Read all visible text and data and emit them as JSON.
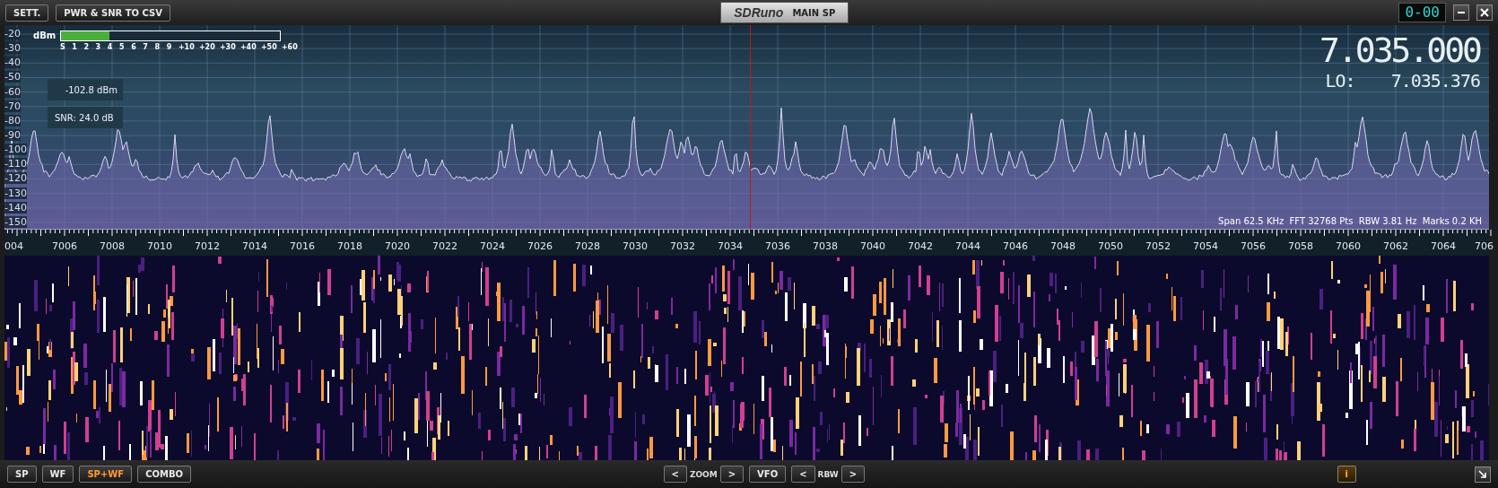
{
  "title_bar": {
    "buttons": [
      "SETT.",
      "PWR & SNR TO CSV"
    ],
    "logo": "SDRuno",
    "window_title": "MAIN SP",
    "clock": "0-00"
  },
  "spectrum": {
    "y_axis_labels": [
      "-20",
      "-30",
      "-40",
      "-50",
      "-60",
      "-70",
      "-80",
      "-90",
      "-100",
      "-110",
      "-120",
      "-130",
      "-140",
      "-150"
    ],
    "s_meter": {
      "unit": "dBm",
      "level": 0.22,
      "scale": [
        "S",
        "1",
        "2",
        "3",
        "4",
        "5",
        "6",
        "7",
        "8",
        "9",
        "+10",
        "+20",
        "+30",
        "+40",
        "+50",
        "+60"
      ]
    },
    "power_reading": "-102.8 dBm",
    "snr_reading": "SNR: 24.0 dB",
    "frequency": "7.035.000",
    "lo_label": "LO:",
    "lo_frequency": "7.035.376",
    "info": "Span 62.5 KHz  FFT 32768 Pts  RBW 3.81 Hz  Marks 0.2 KH"
  },
  "frequency_axis": [
    "004",
    "7006",
    "7008",
    "7010",
    "7012",
    "7014",
    "7016",
    "7018",
    "7020",
    "7022",
    "7024",
    "7026",
    "7028",
    "7030",
    "7032",
    "7034",
    "7036",
    "7038",
    "7040",
    "7042",
    "7044",
    "7046",
    "7048",
    "7050",
    "7052",
    "7054",
    "7056",
    "7058",
    "7060",
    "7062",
    "7064",
    "706"
  ],
  "bottom_bar": {
    "modes": [
      {
        "label": "SP",
        "selected": false
      },
      {
        "label": "WF",
        "selected": false
      },
      {
        "label": "SP+WF",
        "selected": true
      },
      {
        "label": "COMBO",
        "selected": false
      }
    ],
    "zoom": {
      "prev": "<",
      "label": "ZOOM",
      "next": ">"
    },
    "vfo": "VFO",
    "rbw": {
      "prev": "<",
      "label": "RBW",
      "next": ">"
    },
    "info_button": "i"
  }
}
